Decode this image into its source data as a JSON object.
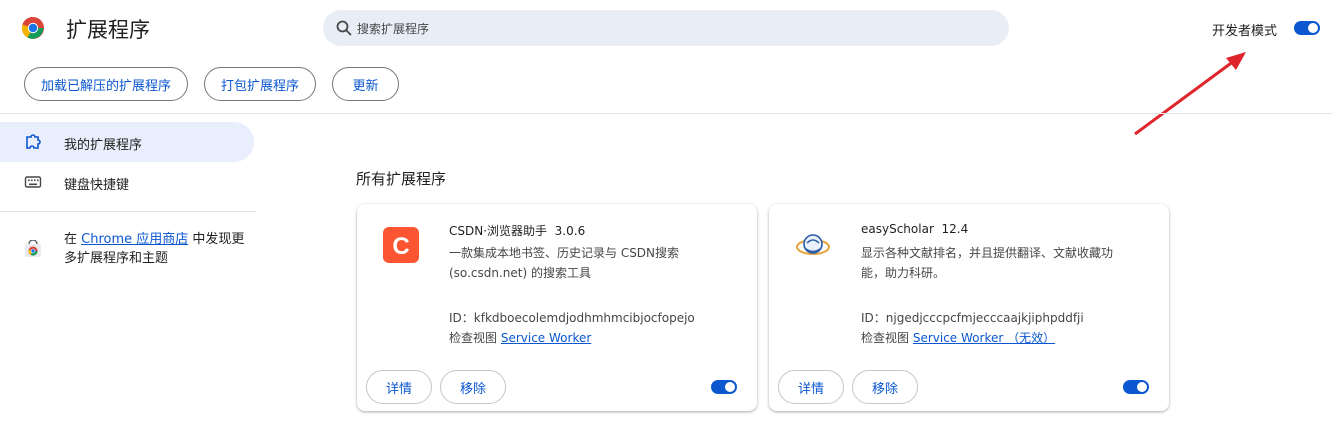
{
  "header": {
    "title": "扩展程序",
    "search_placeholder": "搜索扩展程序",
    "dev_mode_label": "开发者模式",
    "dev_mode_on": true
  },
  "toolbar": {
    "load_unpacked": "加载已解压的扩展程序",
    "pack": "打包扩展程序",
    "update": "更新"
  },
  "sidebar": {
    "items": [
      {
        "label": "我的扩展程序",
        "icon": "puzzle-icon",
        "active": true
      },
      {
        "label": "键盘快捷键",
        "icon": "keyboard-icon",
        "active": false
      }
    ],
    "store_prefix": "在 ",
    "store_link": "Chrome 应用商店",
    "store_suffix": " 中发现更多扩展程序和主题"
  },
  "main": {
    "section_title": "所有扩展程序",
    "extensions": [
      {
        "name": "CSDN·浏览器助手",
        "version": "3.0.6",
        "description": "一款集成本地书签、历史记录与 CSDN搜索(so.csdn.net) 的搜索工具",
        "id_label": "ID：",
        "id": "kfkdboecolemdjodhmhmcibjocfopejo",
        "inspect_label": "检查视图",
        "inspect_link": "Service Worker",
        "details_button": "详情",
        "remove_button": "移除",
        "enabled": true,
        "icon_letter": "C",
        "icon_color": "#fc5531"
      },
      {
        "name": "easyScholar",
        "version": "12.4",
        "description": "显示各种文献排名，并且提供翻译、文献收藏功能，助力科研。",
        "id_label": "ID：",
        "id": "njgedjcccpcfmjecccaajkjiphpddfji",
        "inspect_label": "检查视图",
        "inspect_link": "Service Worker （无效）",
        "details_button": "详情",
        "remove_button": "移除",
        "enabled": true
      }
    ]
  },
  "colors": {
    "accent": "#0b57d0",
    "annotation_arrow": "#e0242b"
  }
}
